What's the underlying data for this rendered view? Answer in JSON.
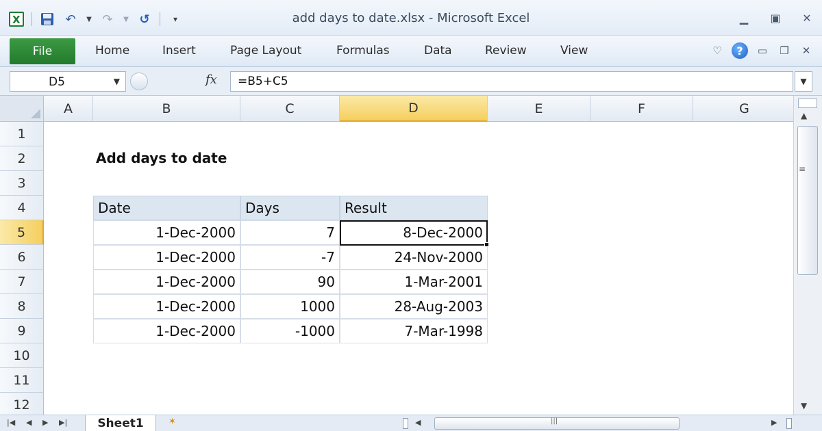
{
  "app": {
    "title": "add days to date.xlsx  -  Microsoft Excel"
  },
  "qat": {
    "excel_icon": "excel-logo-icon",
    "save_icon": "save-icon",
    "undo_icon": "undo-icon",
    "redo_icon": "redo-icon",
    "refresh_icon": "refresh-icon",
    "customize_icon": "customize-qat-icon"
  },
  "ribbon": {
    "file_label": "File",
    "tabs": [
      "Home",
      "Insert",
      "Page Layout",
      "Formulas",
      "Data",
      "Review",
      "View"
    ]
  },
  "formula_bar": {
    "name_box": "D5",
    "fx_label": "fx",
    "formula": "=B5+C5"
  },
  "grid": {
    "columns": [
      "A",
      "B",
      "C",
      "D",
      "E",
      "F",
      "G"
    ],
    "rows": [
      "1",
      "2",
      "3",
      "4",
      "5",
      "6",
      "7",
      "8",
      "9",
      "10",
      "11",
      "12"
    ],
    "selected_column": "D",
    "selected_row": "5",
    "active_cell": "D5"
  },
  "sheet": {
    "title": "Add days to date",
    "headers": [
      "Date",
      "Days",
      "Result"
    ],
    "rows": [
      [
        "1-Dec-2000",
        "7",
        "8-Dec-2000"
      ],
      [
        "1-Dec-2000",
        "-7",
        "24-Nov-2000"
      ],
      [
        "1-Dec-2000",
        "90",
        "1-Mar-2001"
      ],
      [
        "1-Dec-2000",
        "1000",
        "28-Aug-2003"
      ],
      [
        "1-Dec-2000",
        "-1000",
        "7-Mar-1998"
      ]
    ]
  },
  "tabs_bar": {
    "sheet_name": "Sheet1"
  },
  "colors": {
    "file_tab": "#2e8a36",
    "header_fill": "#dce6f1",
    "selected_header": "#f5cf5e",
    "help_icon": "#1b5fc2"
  }
}
